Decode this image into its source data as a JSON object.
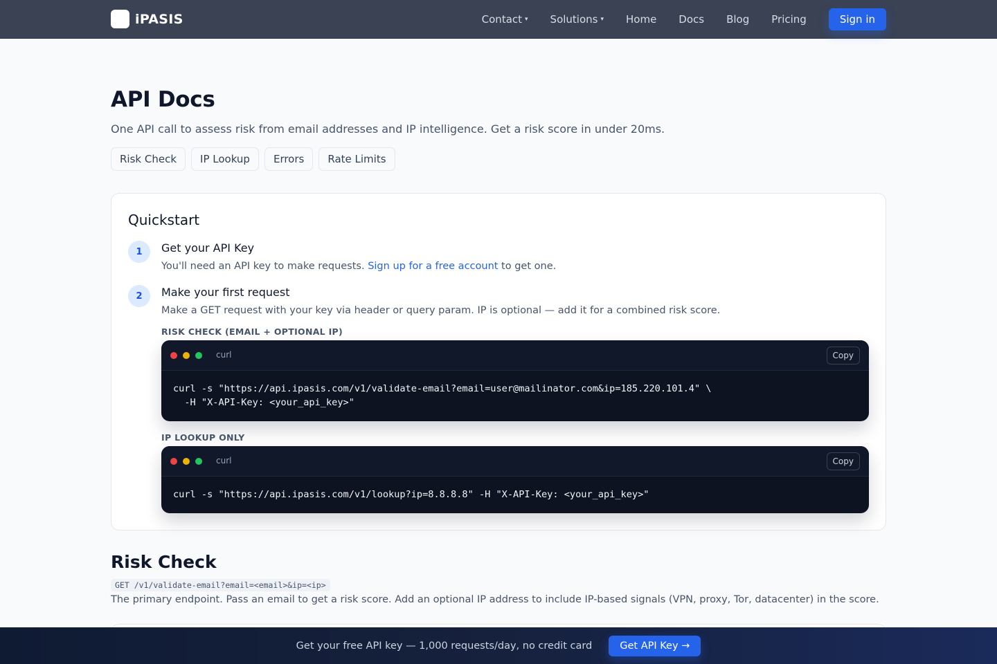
{
  "brand": {
    "name": "iPASIS"
  },
  "nav": {
    "items": [
      {
        "label": "Contact",
        "has_caret": true
      },
      {
        "label": "Solutions",
        "has_caret": true
      },
      {
        "label": "Home"
      },
      {
        "label": "Docs"
      },
      {
        "label": "Blog"
      },
      {
        "label": "Pricing"
      }
    ],
    "caret": "▾",
    "signin_label": "Sign in"
  },
  "page": {
    "title": "API Docs",
    "subtitle": "One API call to assess risk from email addresses and IP intelligence. Get a risk score in under 20ms.",
    "pills": [
      "Risk Check",
      "IP Lookup",
      "Errors",
      "Rate Limits"
    ]
  },
  "quickstart": {
    "title": "Quickstart",
    "steps": [
      {
        "number": "1",
        "title": "Get your API Key",
        "desc_before": "You'll need an API key to make requests. ",
        "link": "Sign up for a free account",
        "desc_after": " to get one."
      },
      {
        "number": "2",
        "title": "Make your first request",
        "desc": "Make a GET request with your key via header or query param. IP is optional — add it for a combined risk score."
      }
    ],
    "blocks": [
      {
        "label": "RISK CHECK (EMAIL + OPTIONAL IP)",
        "lang": "curl",
        "copy_label": "Copy",
        "code": "curl -s \"https://api.ipasis.com/v1/validate-email?email=user@mailinator.com&ip=185.220.101.4\" \\\n  -H \"X-API-Key: <your_api_key>\""
      },
      {
        "label": "IP LOOKUP ONLY",
        "lang": "curl",
        "copy_label": "Copy",
        "code": "curl -s \"https://api.ipasis.com/v1/lookup?ip=8.8.8.8\" -H \"X-API-Key: <your_api_key>\""
      }
    ]
  },
  "risk_check": {
    "title": "Risk Check",
    "endpoint": "GET /v1/validate-email?email=<email>&ip=<ip>",
    "desc": "The primary endpoint. Pass an email to get a risk score. Add an optional IP address to include IP-based signals (VPN, proxy, Tor, datacenter) in the score."
  },
  "banner": {
    "text": "Get your free API key — 1,000 requests/day, no credit card",
    "button_label": "Get API Key →"
  },
  "colors": {
    "accent": "#2563eb",
    "topbar": "#3a4254",
    "code_bg": "#0d1320"
  }
}
